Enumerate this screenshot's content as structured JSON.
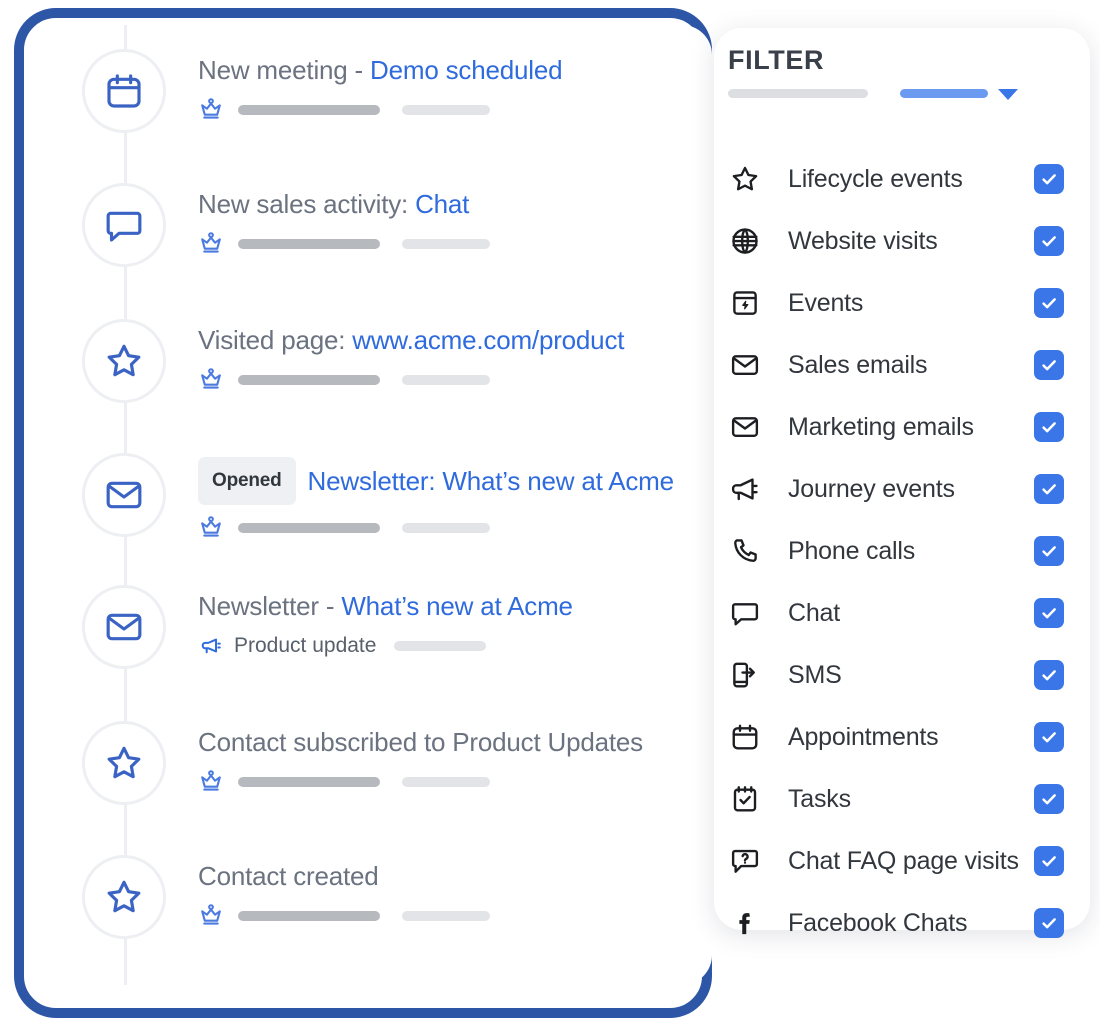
{
  "timeline": {
    "items": [
      {
        "icon": "calendar-icon",
        "title_plain": "New meeting - ",
        "title_link": "Demo scheduled",
        "meta_icon": "crown-icon",
        "meta_text": "",
        "bars": "two"
      },
      {
        "icon": "chat-bubble-icon",
        "title_plain": "New sales activity: ",
        "title_link": "Chat",
        "meta_icon": "crown-icon",
        "meta_text": "",
        "bars": "two"
      },
      {
        "icon": "star-icon",
        "title_plain": "Visited page: ",
        "title_link": "www.acme.com/product",
        "meta_icon": "crown-icon",
        "meta_text": "",
        "bars": "two"
      },
      {
        "icon": "envelope-icon",
        "badge": "Opened",
        "title_plain": "",
        "title_link": "Newsletter: What’s new at Acme",
        "meta_icon": "crown-icon",
        "meta_text": "",
        "bars": "two"
      },
      {
        "icon": "envelope-icon",
        "title_plain": "Newsletter - ",
        "title_link": "What’s new at Acme",
        "meta_icon": "megaphone-icon",
        "meta_text": "Product update",
        "bars": "one"
      },
      {
        "icon": "star-icon",
        "title_plain": "Contact subscribed to Product Updates",
        "title_link": "",
        "meta_icon": "crown-icon",
        "meta_text": "",
        "bars": "two"
      },
      {
        "icon": "star-icon",
        "title_plain": "Contact created",
        "title_link": "",
        "meta_icon": "crown-icon",
        "meta_text": "",
        "bars": "two"
      }
    ]
  },
  "filter": {
    "title": "FILTER",
    "items": [
      {
        "icon": "star-icon",
        "label": "Lifecycle events",
        "checked": true
      },
      {
        "icon": "globe-icon",
        "label": "Website visits",
        "checked": true
      },
      {
        "icon": "event-bolt-icon",
        "label": "Events",
        "checked": true
      },
      {
        "icon": "envelope-icon",
        "label": "Sales emails",
        "checked": true
      },
      {
        "icon": "envelope-icon",
        "label": "Marketing emails",
        "checked": true
      },
      {
        "icon": "megaphone-icon",
        "label": "Journey events",
        "checked": true
      },
      {
        "icon": "phone-icon",
        "label": "Phone calls",
        "checked": true
      },
      {
        "icon": "chat-bubble-icon",
        "label": "Chat",
        "checked": true
      },
      {
        "icon": "sms-icon",
        "label": "SMS",
        "checked": true
      },
      {
        "icon": "calendar-icon",
        "label": "Appointments",
        "checked": true
      },
      {
        "icon": "task-check-icon",
        "label": "Tasks",
        "checked": true
      },
      {
        "icon": "chat-question-icon",
        "label": "Chat FAQ page visits",
        "checked": true
      },
      {
        "icon": "facebook-icon",
        "label": "Facebook Chats",
        "checked": true
      }
    ]
  },
  "colors": {
    "frame_blue": "#2E56A6",
    "link_blue": "#2F6BDD",
    "checkbox_blue": "#3B76E8",
    "icon_blue": "#3A63C4",
    "text_gray": "#6B7280",
    "label_dark": "#32373E"
  }
}
